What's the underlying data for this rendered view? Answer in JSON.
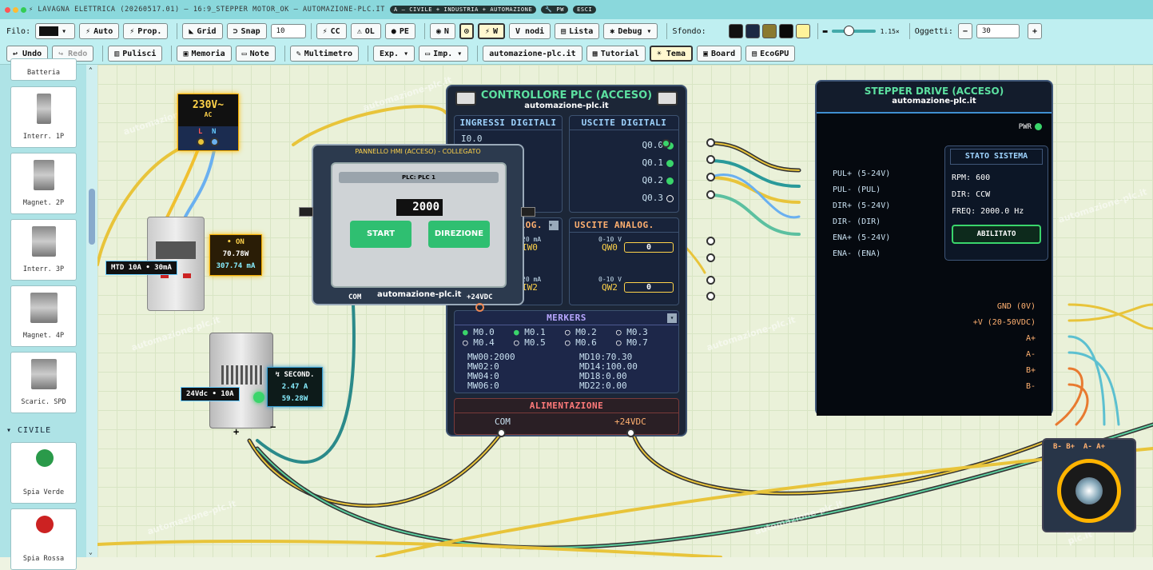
{
  "titlebar": {
    "title": "⚡ LAVAGNA ELETTRICA (20260517.01) — 16:9_STEPPER MOTOR_OK — AUTOMAZIONE-PLC.IT",
    "pill1": "A — CIVILE + INDUSTRIA + AUTOMAZIONE",
    "pill2": "🔧 PW",
    "pill3": "ESCI"
  },
  "toolbar1": {
    "filo_label": "Filo:",
    "auto": "Auto",
    "prop": "Prop.",
    "grid": "Grid",
    "snap": "Snap",
    "snap_value": "10",
    "cc": "CC",
    "ol": "OL",
    "pe": "PE",
    "n": "N",
    "w": "W",
    "vnodi": "V nodi",
    "lista": "Lista",
    "debug": "Debug ▾",
    "sfondo_label": "Sfondo:",
    "zoom": "1.15×",
    "oggetti_label": "Oggetti:",
    "minus": "−",
    "oggetti_value": "30",
    "plus": "+",
    "colors": [
      "#111111",
      "#1c2a44",
      "#8a7a30",
      "#0a0a0a",
      "#fff39a"
    ]
  },
  "toolbar2": {
    "undo": "↩ Undo",
    "redo": "↪ Redo",
    "pulisci": "Pulisci",
    "memoria": "Memoria",
    "note": "Note",
    "multimetro": "Multimetro",
    "exp": "Exp. ▾",
    "imp": "Imp. ▾",
    "site": "automazione-plc.it",
    "tutorial": "Tutorial",
    "tema": "☀ Tema",
    "board": "Board",
    "ecogpu": "EcoGPU"
  },
  "sidebar": {
    "top_label": "Batteria",
    "items": [
      "Interr. 1P",
      "Magnet. 2P",
      "Interr. 3P",
      "Magnet. 4P",
      "Scaric. SPD"
    ],
    "section": "▾ CIVILE",
    "civile_items": [
      "Spia Verde",
      "Spia Rossa"
    ]
  },
  "watermark": "automazione-plc.it",
  "supply": {
    "voltage": "230V~",
    "type": "AC",
    "l": "L",
    "n": "N"
  },
  "breaker": {
    "tag": "MTD 10A • 30mA",
    "status": "• ON",
    "power": "70.78W",
    "current": "307.74 mA"
  },
  "psu": {
    "tag": "24Vdc • 10A",
    "status": "↯ SECOND.",
    "current": "2.47 A",
    "power": "59.28W",
    "plus": "+",
    "minus": "−"
  },
  "hmi": {
    "title": "PANNELLO HMI (ACCESO) - COLLEGATO",
    "plc_label": "PLC: PLC 1",
    "value": "2000",
    "start": "START",
    "direzione": "DIREZIONE",
    "brand": "automazione-plc.it",
    "com": "COM",
    "vdc": "+24VDC"
  },
  "plc": {
    "title": "CONTROLLORE PLC (ACCESO)",
    "subtitle": "automazione-plc.it",
    "di_title": "INGRESSI DIGITALI",
    "do_title": "USCITE DIGITALI",
    "di_first": "I0.0",
    "outputs": [
      {
        "label": "Q0.0",
        "on": true
      },
      {
        "label": "Q0.1",
        "on": true
      },
      {
        "label": "Q0.2",
        "on": true
      },
      {
        "label": "Q0.3",
        "on": false
      }
    ],
    "ai_title": "LOG.",
    "ao_title": "USCITE ANALOG.",
    "ai_rows": [
      "20 mA",
      "IW0",
      "20 mA",
      "IW2"
    ],
    "ao_rows": [
      {
        "range": "0-10 V",
        "label": "QW0",
        "value": "0"
      },
      {
        "range": "0-10 V",
        "label": "QW2",
        "value": "0"
      }
    ],
    "merkers_title": "MERKERS",
    "merkers": [
      {
        "label": "M0.0",
        "on": true
      },
      {
        "label": "M0.1",
        "on": true
      },
      {
        "label": "M0.2",
        "on": false
      },
      {
        "label": "M0.3",
        "on": false
      },
      {
        "label": "M0.4",
        "on": false
      },
      {
        "label": "M0.5",
        "on": false
      },
      {
        "label": "M0.6",
        "on": false
      },
      {
        "label": "M0.7",
        "on": false
      }
    ],
    "words": [
      "MW00:2000",
      "MW02:0",
      "MW04:0",
      "MW06:0"
    ],
    "dwords": [
      "MD10:70.30",
      "MD14:100.00",
      "MD18:0.00",
      "MD22:0.00"
    ],
    "power_title": "ALIMENTAZIONE",
    "com": "COM",
    "vdc": "+24VDC"
  },
  "stepper": {
    "title": "STEPPER DRIVE (ACCESO)",
    "subtitle": "automazione-plc.it",
    "pwr": "PWR",
    "inputs": [
      "PUL+ (5-24V)",
      "PUL- (PUL)",
      "DIR+ (5-24V)",
      "DIR- (DIR)",
      "ENA+ (5-24V)",
      "ENA- (ENA)"
    ],
    "status_title": "STATO SISTEMA",
    "rpm": "RPM: 600",
    "dir": "DIR: CCW",
    "freq": "FREQ: 2000.0 Hz",
    "enabled": "ABILITATO",
    "power_rows": [
      "GND (0V)",
      "+V (20-50VDC)",
      "A+",
      "A-",
      "B+",
      "B-"
    ]
  },
  "motor": {
    "labels": "B- B+  A- A+"
  }
}
